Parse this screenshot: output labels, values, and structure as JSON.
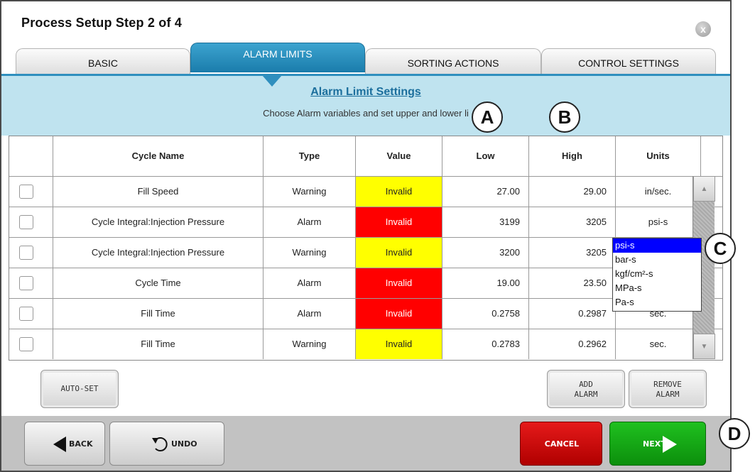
{
  "window": {
    "title": "Process Setup   Step 2 of 4",
    "close_symbol": "x"
  },
  "tabs": [
    {
      "label": "BASIC"
    },
    {
      "label": "ALARM LIMITS",
      "active": true
    },
    {
      "label": "SORTING ACTIONS"
    },
    {
      "label": "CONTROL SETTINGS"
    }
  ],
  "banner": {
    "title": "Alarm Limit Settings",
    "subtitle": "Choose Alarm variables and set upper and lower li"
  },
  "table": {
    "columns": [
      "Cycle Name",
      "Type",
      "Value",
      "Low",
      "High",
      "Units"
    ],
    "rows": [
      {
        "name": "Fill Speed",
        "type": "Warning",
        "value": "Invalid",
        "low": "27.00",
        "high": "29.00",
        "units": "in/sec."
      },
      {
        "name": "Cycle Integral:Injection Pressure",
        "type": "Alarm",
        "value": "Invalid",
        "low": "3199",
        "high": "3205",
        "units": "psi-s"
      },
      {
        "name": "Cycle Integral:Injection Pressure",
        "type": "Warning",
        "value": "Invalid",
        "low": "3200",
        "high": "3205",
        "units": ""
      },
      {
        "name": "Cycle Time",
        "type": "Alarm",
        "value": "Invalid",
        "low": "19.00",
        "high": "23.50",
        "units": ""
      },
      {
        "name": "Fill Time",
        "type": "Alarm",
        "value": "Invalid",
        "low": "0.2758",
        "high": "0.2987",
        "units": "sec."
      },
      {
        "name": "Fill Time",
        "type": "Warning",
        "value": "Invalid",
        "low": "0.2783",
        "high": "0.2962",
        "units": "sec."
      }
    ]
  },
  "units_dropdown": {
    "options": [
      "psi-s",
      "bar-s",
      "kgf/cm²-s",
      "MPa-s",
      "Pa-s"
    ],
    "selected": "psi-s"
  },
  "buttons": {
    "auto_set": "AUTO-SET",
    "add_alarm": [
      "ADD",
      "ALARM"
    ],
    "remove_alarm": [
      "REMOVE",
      "ALARM"
    ],
    "back": "BACK",
    "undo": "UNDO",
    "cancel": "CANCEL",
    "next": "NEXT"
  },
  "callouts": [
    "A",
    "B",
    "C",
    "D"
  ],
  "colors": {
    "warning": "#ffff00",
    "alarm": "#ff0000",
    "tab_active": "#1a7cab",
    "banner": "#bfe3ef",
    "cancel": "#d40000",
    "next": "#14a514"
  }
}
